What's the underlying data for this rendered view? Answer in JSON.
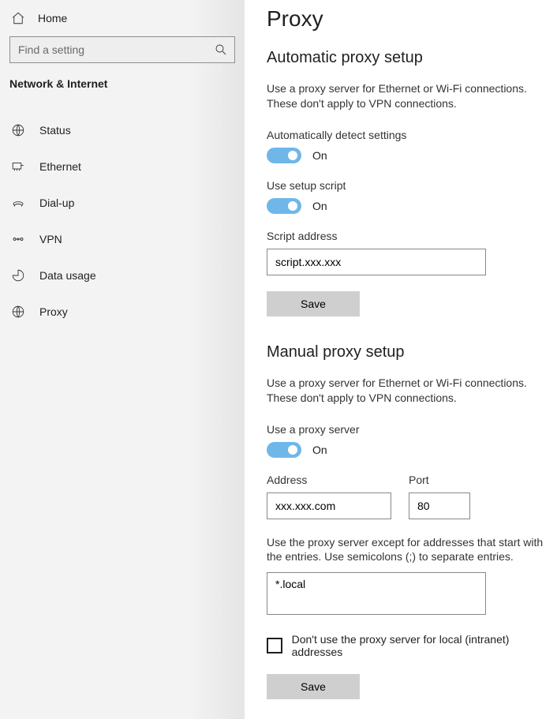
{
  "sidebar": {
    "home_label": "Home",
    "search_placeholder": "Find a setting",
    "section_title": "Network & Internet",
    "items": [
      {
        "label": "Status",
        "icon": "status-icon"
      },
      {
        "label": "Ethernet",
        "icon": "ethernet-icon"
      },
      {
        "label": "Dial-up",
        "icon": "dialup-icon"
      },
      {
        "label": "VPN",
        "icon": "vpn-icon"
      },
      {
        "label": "Data usage",
        "icon": "data-usage-icon"
      },
      {
        "label": "Proxy",
        "icon": "proxy-icon"
      }
    ]
  },
  "main": {
    "page_title": "Proxy",
    "auto": {
      "title": "Automatic proxy setup",
      "desc": "Use a proxy server for Ethernet or Wi-Fi connections. These don't apply to VPN connections.",
      "detect_label": "Automatically detect settings",
      "detect_state": "On",
      "script_label": "Use setup script",
      "script_state": "On",
      "address_label": "Script address",
      "address_value": "script.xxx.xxx",
      "save_label": "Save"
    },
    "manual": {
      "title": "Manual proxy setup",
      "desc": "Use a proxy server for Ethernet or Wi-Fi connections. These don't apply to VPN connections.",
      "use_label": "Use a proxy server",
      "use_state": "On",
      "address_label": "Address",
      "address_value": "xxx.xxx.com",
      "port_label": "Port",
      "port_value": "80",
      "except_desc": "Use the proxy server except for addresses that start with the entries. Use semicolons (;) to separate entries.",
      "except_value": "*.local",
      "bypass_label": "Don't use the proxy server for local (intranet) addresses",
      "save_label": "Save"
    }
  }
}
